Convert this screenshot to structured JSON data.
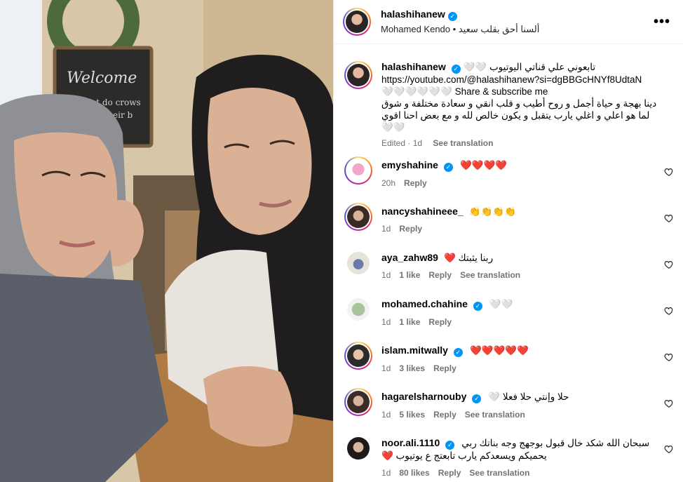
{
  "post": {
    "username": "halashihanew",
    "subtitle_song": "ألسنا أحق بقلب سعيد",
    "subtitle_artist": "Mohamed Kendo",
    "subtitle_sep": "•",
    "more_label": "•••"
  },
  "caption": {
    "username": "halashihanew",
    "line1": "تابعوني علي قناتي اليوتيوب 🤍🤍",
    "line2": "https://youtube.com/@halashihanew?si=dgBBGcHNYf8UdtaN",
    "line3": "🤍🤍🤍🤍🤍🤍 Share & subscribe me",
    "line4": "دينا بهجة و حياة أجمل و روح أطيب و قلب انقي و سعادة مختلفة و شوق",
    "line5": "لما هو اعلي و اغلي يارب يتقبل و يكون خالص لله و مع بعض احنا اقوي 🤍🤍",
    "edited": "Edited",
    "time": "1d",
    "translate": "See translation"
  },
  "comments": [
    {
      "username": "emyshahine",
      "verified": true,
      "text": "❤️❤️❤️❤️",
      "time": "20h",
      "likes": "",
      "reply": "Reply",
      "translate": ""
    },
    {
      "username": "nancyshahineee_",
      "verified": false,
      "text": "👏👏👏👏",
      "time": "1d",
      "likes": "",
      "reply": "Reply",
      "translate": ""
    },
    {
      "username": "aya_zahw89",
      "verified": false,
      "text": "ربنا يثبتك ❤️",
      "time": "1d",
      "likes": "1 like",
      "reply": "Reply",
      "translate": "See translation"
    },
    {
      "username": "mohamed.chahine",
      "verified": true,
      "text": "🤍🤍",
      "time": "1d",
      "likes": "1 like",
      "reply": "Reply",
      "translate": ""
    },
    {
      "username": "islam.mitwally",
      "verified": true,
      "text": "❤️❤️❤️❤️❤️",
      "time": "1d",
      "likes": "3 likes",
      "reply": "Reply",
      "translate": ""
    },
    {
      "username": "hagarelsharnouby",
      "verified": true,
      "text": "حلا وإنتي حلا فعلا 🤍",
      "time": "1d",
      "likes": "5 likes",
      "reply": "Reply",
      "translate": "See translation"
    },
    {
      "username": "noor.ali.1110",
      "verified": true,
      "text": "سبحان الله شكد خال قبول بوجهج وجه بناتك ربي",
      "text2": "يحميكم ويسعدكم يارب تابعتج ع يوتيوب ❤️",
      "time": "1d",
      "likes": "80 likes",
      "reply": "Reply",
      "translate": "See translation"
    }
  ],
  "colors": {
    "verified": "#0095f6",
    "meta": "#737373",
    "heart": "#ed4956"
  },
  "icons": {
    "verified": "verified-badge-icon",
    "like": "heart-outline-icon",
    "more": "more-options-icon"
  }
}
